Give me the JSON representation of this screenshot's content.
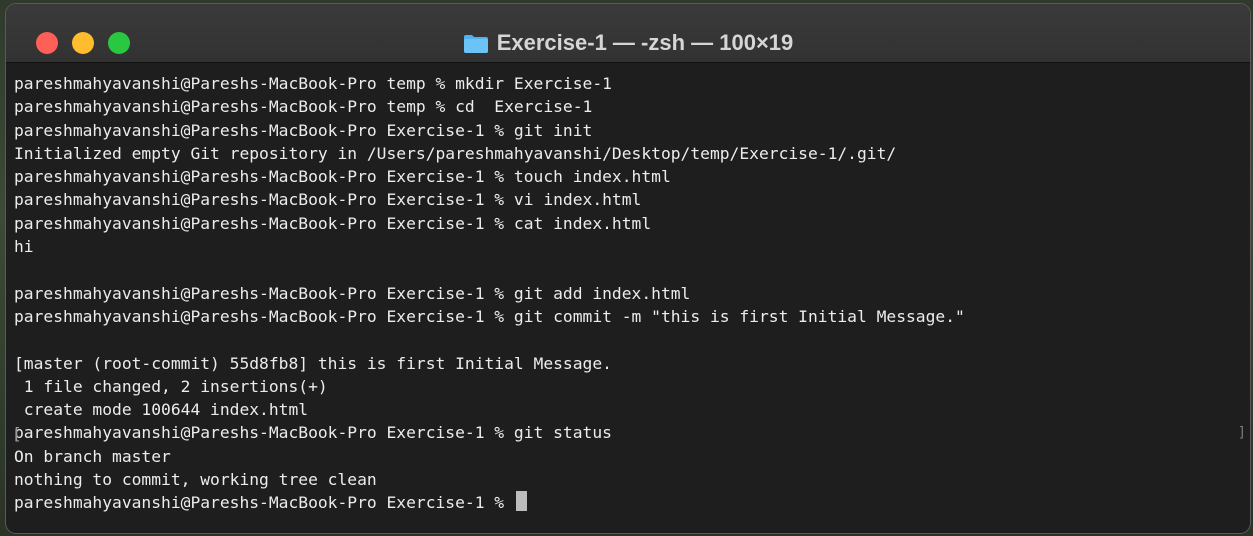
{
  "window": {
    "title": "Exercise-1 — -zsh — 100×19",
    "title_icon": "folder-icon"
  },
  "terminal": {
    "lines": [
      "pareshmahyavanshi@Pareshs-MacBook-Pro temp % mkdir Exercise-1",
      "pareshmahyavanshi@Pareshs-MacBook-Pro temp % cd  Exercise-1",
      "pareshmahyavanshi@Pareshs-MacBook-Pro Exercise-1 % git init",
      "Initialized empty Git repository in /Users/pareshmahyavanshi/Desktop/temp/Exercise-1/.git/",
      "pareshmahyavanshi@Pareshs-MacBook-Pro Exercise-1 % touch index.html",
      "pareshmahyavanshi@Pareshs-MacBook-Pro Exercise-1 % vi index.html",
      "pareshmahyavanshi@Pareshs-MacBook-Pro Exercise-1 % cat index.html",
      "hi",
      "",
      "pareshmahyavanshi@Pareshs-MacBook-Pro Exercise-1 % git add index.html",
      "pareshmahyavanshi@Pareshs-MacBook-Pro Exercise-1 % git commit -m \"this is first Initial Message.\"",
      "",
      "[master (root-commit) 55d8fb8] this is first Initial Message.",
      " 1 file changed, 2 insertions(+)",
      " create mode 100644 index.html",
      "pareshmahyavanshi@Pareshs-MacBook-Pro Exercise-1 % git status",
      "On branch master",
      "nothing to commit, working tree clean",
      "pareshmahyavanshi@Pareshs-MacBook-Pro Exercise-1 % "
    ],
    "bracket_left": "[",
    "bracket_right": "]"
  },
  "colors": {
    "close": "#fe5f57",
    "minimize": "#febc2e",
    "maximize": "#28c840",
    "terminal_bg": "#1e1e1e",
    "text": "#ececec",
    "folder": "#4fb3f0"
  }
}
